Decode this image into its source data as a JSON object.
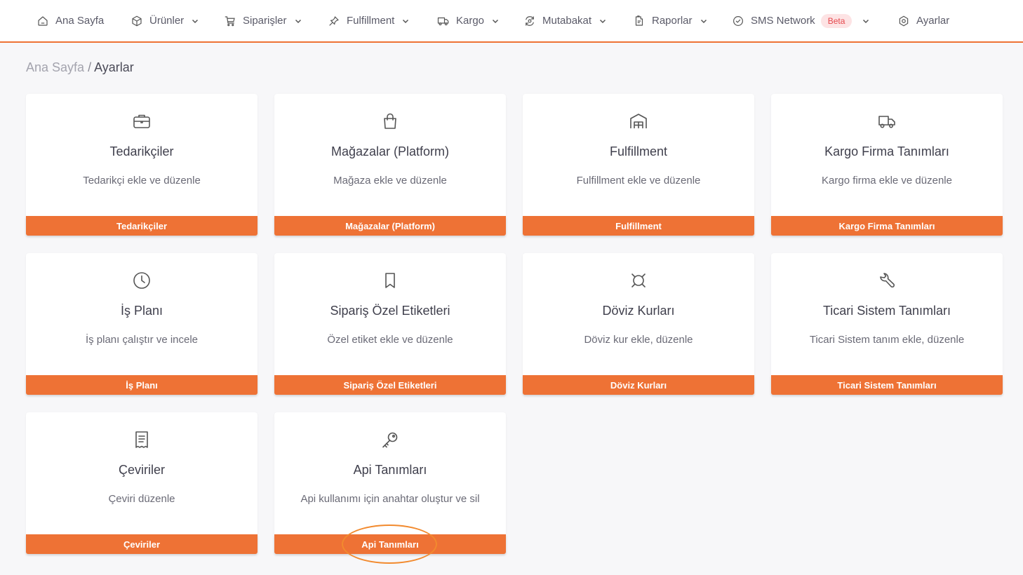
{
  "nav": {
    "items": [
      {
        "label": "Ana Sayfa",
        "icon": "home-icon",
        "has_dropdown": false
      },
      {
        "label": "Ürünler",
        "icon": "box-icon",
        "has_dropdown": true
      },
      {
        "label": "Siparişler",
        "icon": "cart-icon",
        "has_dropdown": true
      },
      {
        "label": "Fulfillment",
        "icon": "pin-icon",
        "has_dropdown": true
      },
      {
        "label": "Kargo",
        "icon": "truck-icon",
        "has_dropdown": true
      },
      {
        "label": "Mutabakat",
        "icon": "reconcile-icon",
        "has_dropdown": true
      },
      {
        "label": "Raporlar",
        "icon": "report-icon",
        "has_dropdown": true
      },
      {
        "label": "SMS Network",
        "icon": "check-circle-icon",
        "has_dropdown": true,
        "badge": "Beta"
      },
      {
        "label": "Ayarlar",
        "icon": "settings-icon",
        "has_dropdown": false
      }
    ]
  },
  "breadcrumb": {
    "home": "Ana Sayfa",
    "separator": "/",
    "current": "Ayarlar"
  },
  "cards": [
    {
      "icon": "briefcase-icon",
      "title": "Tedarikçiler",
      "desc": "Tedarikçi ekle ve düzenle",
      "button": "Tedarikçiler"
    },
    {
      "icon": "shopping-bag-icon",
      "title": "Mağazalar (Platform)",
      "desc": "Mağaza ekle ve düzenle",
      "button": "Mağazalar (Platform)"
    },
    {
      "icon": "warehouse-icon",
      "title": "Fulfillment",
      "desc": "Fulfillment ekle ve düzenle",
      "button": "Fulfillment"
    },
    {
      "icon": "truck-icon",
      "title": "Kargo Firma Tanımları",
      "desc": "Kargo firma ekle ve düzenle",
      "button": "Kargo Firma Tanımları"
    },
    {
      "icon": "clock-icon",
      "title": "İş Planı",
      "desc": "İş planı çalıştır ve incele",
      "button": "İş Planı"
    },
    {
      "icon": "bookmark-icon",
      "title": "Sipariş Özel Etiketleri",
      "desc": "Özel etiket ekle ve düzenle",
      "button": "Sipariş Özel Etiketleri"
    },
    {
      "icon": "currency-icon",
      "title": "Döviz Kurları",
      "desc": "Döviz kur ekle, düzenle",
      "button": "Döviz Kurları"
    },
    {
      "icon": "wrench-icon",
      "title": "Ticari Sistem Tanımları",
      "desc": "Ticari Sistem tanım ekle, düzenle",
      "button": "Ticari Sistem Tanımları"
    },
    {
      "icon": "receipt-icon",
      "title": "Çeviriler",
      "desc": "Çeviri düzenle",
      "button": "Çeviriler"
    },
    {
      "icon": "key-icon",
      "title": "Api Tanımları",
      "desc": "Api kullanımı için anahtar oluştur ve sil",
      "button": "Api Tanımları"
    }
  ],
  "colors": {
    "accent": "#ee7235",
    "highlight_ring": "#f28a2e",
    "badge_bg": "#fde3e4",
    "badge_text": "#e5484d"
  },
  "highlighted_button": "Api Tanımları"
}
